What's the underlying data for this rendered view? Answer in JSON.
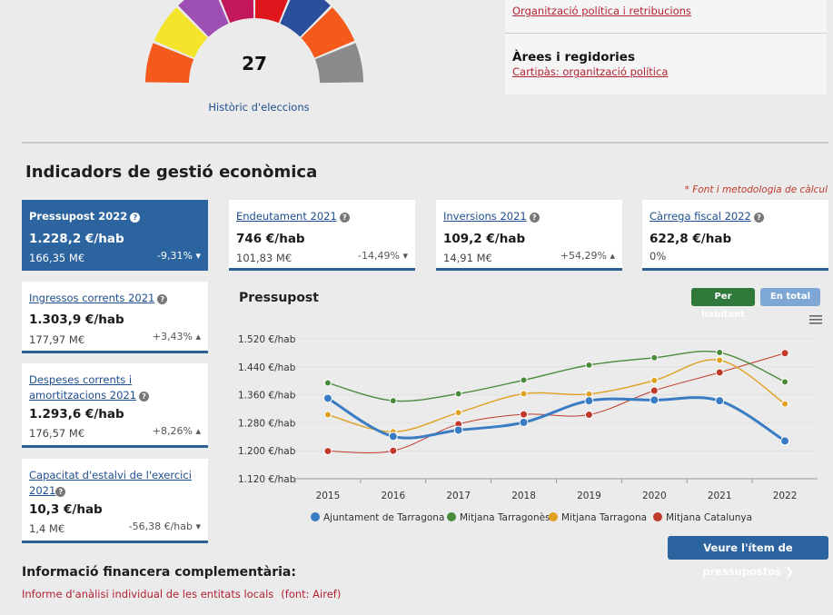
{
  "elections": {
    "seats_total": "27",
    "history_link": "Històric d'eleccions",
    "seat_colors": [
      "#f35a1c",
      "#f5e52a",
      "#9d4fb3",
      "#c2185b",
      "#e0161d",
      "#2b4f9c",
      "#f35a1c",
      "#8a8a8a"
    ]
  },
  "org": {
    "link": "Organització política i retribucions",
    "areas_title": "Àrees i regidories",
    "areas_link": "Cartipàs: organització política"
  },
  "section": {
    "title": "Indicadors de gestió econòmica",
    "source_note": "* Font i metodologia de càlcul"
  },
  "cards": {
    "budget": {
      "title": "Pressupost 2022",
      "value": "1.228,2 €/hab",
      "total": "166,35 M€",
      "change": "-9,31%",
      "trend": "down"
    },
    "debt": {
      "title": "Endeutament 2021",
      "value": "746 €/hab",
      "total": "101,83 M€",
      "change": "-14,49%",
      "trend": "down"
    },
    "investments": {
      "title": "Inversions 2021",
      "value": "109,2 €/hab",
      "total": "14,91 M€",
      "change": "+54,29%",
      "trend": "up"
    },
    "fiscal": {
      "title": "Càrrega fiscal 2022",
      "value": "622,8 €/hab",
      "total": "0%"
    },
    "income": {
      "title": "Ingressos corrents 2021",
      "value": "1.303,9 €/hab",
      "total": "177,97 M€",
      "change": "+3,43%",
      "trend": "up"
    },
    "expenses": {
      "title": "Despeses corrents i amortitzacions 2021",
      "value": "1.293,6 €/hab",
      "total": "176,57 M€",
      "change": "+8,26%",
      "trend": "up"
    },
    "savings": {
      "title": "Capacitat d'estalvi de l'exercici 2021",
      "value": "10,3 €/hab",
      "total": "1,4 M€",
      "change": "-56,38 €/hab",
      "trend": "down"
    }
  },
  "chart": {
    "title": "Pressupost",
    "btn_per_hab": "Per habitant",
    "btn_total": "En total"
  },
  "chart_data": {
    "type": "line",
    "title": "Pressupost",
    "x": [
      "2015",
      "2016",
      "2017",
      "2018",
      "2019",
      "2020",
      "2021",
      "2022"
    ],
    "y_ticks": [
      "1.120 €/hab",
      "1.200 €/hab",
      "1.280 €/hab",
      "1.360 €/hab",
      "1.440 €/hab",
      "1.520 €/hab"
    ],
    "ylim": [
      1120,
      1520
    ],
    "grid": true,
    "legend_placement": "bottom",
    "series": [
      {
        "name": "Ajuntament de Tarragona",
        "color": "#3a7cc4",
        "values": [
          1350,
          1241,
          1259,
          1281,
          1343,
          1345,
          1343,
          1228
        ]
      },
      {
        "name": "Mitjana Tarragonès",
        "color": "#4a8a3a",
        "values": [
          1394,
          1343,
          1363,
          1402,
          1445,
          1466,
          1481,
          1397
        ]
      },
      {
        "name": "Mitjana Tarragona",
        "color": "#e0a020",
        "values": [
          1303,
          1254,
          1309,
          1363,
          1362,
          1401,
          1459,
          1334
        ]
      },
      {
        "name": "Mitjana Catalunya",
        "color": "#c0392b",
        "values": [
          1199,
          1200,
          1276,
          1304,
          1303,
          1372,
          1424,
          1479
        ]
      }
    ]
  },
  "cta": {
    "label": "Veure l'ítem de pressupostos ❯"
  },
  "extra": {
    "title": "Informació financera complementària:",
    "link": "Informe d'anàlisi individual de les entitats locals",
    "source": "(font: Airef)"
  }
}
